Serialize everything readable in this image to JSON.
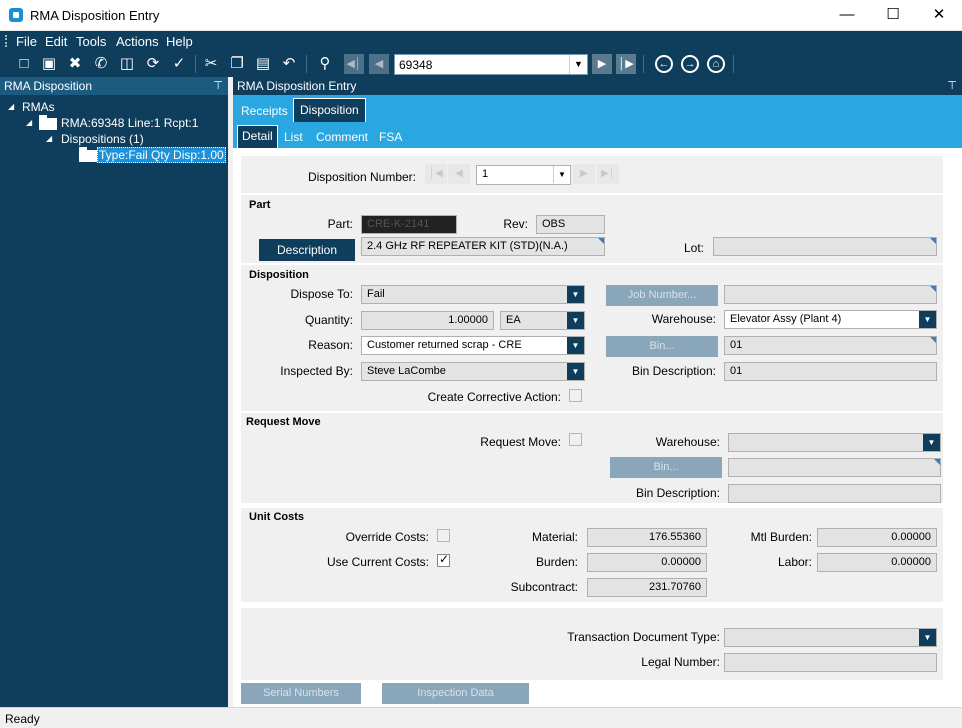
{
  "window": {
    "title": "RMA Disposition Entry",
    "minimize_glyph": "—",
    "maximize_glyph": "☐",
    "close_glyph": "✕"
  },
  "menu": [
    "File",
    "Edit",
    "Tools",
    "Actions",
    "Help"
  ],
  "toolbar": {
    "record_value": "69348",
    "icons": [
      "new-icon",
      "save-icon",
      "delete-icon",
      "phone-icon",
      "attach-icon",
      "refresh-icon",
      "clear-icon",
      "cut-icon",
      "copy-icon",
      "paste-icon",
      "undo-icon",
      "search-icon",
      "first-icon",
      "prev-icon",
      "next-icon",
      "last-icon",
      "back-icon",
      "forward-icon",
      "home-icon"
    ]
  },
  "left_panel": {
    "title": "RMA Disposition",
    "tree": {
      "root": "RMAs",
      "rma": "RMA:69348 Line:1 Rcpt:1",
      "dispositions": "Dispositions (1)",
      "item": "Type:Fail Qty Disp:1.00"
    }
  },
  "right_panel": {
    "title": "RMA Disposition Entry",
    "tabs": [
      "Receipts",
      "Disposition"
    ],
    "active_tab": "Disposition",
    "subtabs": [
      "Detail",
      "List",
      "Comment",
      "FSA"
    ],
    "active_subtab": "Detail"
  },
  "form": {
    "disposition_number": {
      "label": "Disposition Number:",
      "value": "1"
    },
    "part_group": {
      "title": "Part",
      "part_label": "Part:",
      "part_value": "CRE-K-2141",
      "rev_label": "Rev:",
      "rev_value": "OBS",
      "description_button": "Description",
      "description_value": "2.4 GHz RF REPEATER KIT (STD)(N.A.)",
      "lot_label": "Lot:",
      "lot_value": ""
    },
    "disposition_group": {
      "title": "Disposition",
      "dispose_to_label": "Dispose To:",
      "dispose_to_value": "Fail",
      "quantity_label": "Quantity:",
      "quantity_value": "1.00000",
      "uom_value": "EA",
      "reason_label": "Reason:",
      "reason_value": "Customer returned scrap - CRE",
      "inspected_by_label": "Inspected By:",
      "inspected_by_value": "Steve LaCombe",
      "corrective_label": "Create Corrective Action:",
      "job_number_button": "Job Number...",
      "job_number_value": "",
      "warehouse_label": "Warehouse:",
      "warehouse_value": "Elevator Assy (Plant 4)",
      "bin_button": "Bin...",
      "bin_value": "01",
      "bin_desc_label": "Bin Description:",
      "bin_desc_value": "01"
    },
    "request_move_group": {
      "title": "Request Move",
      "request_move_label": "Request Move:",
      "warehouse_label": "Warehouse:",
      "warehouse_value": "",
      "bin_button": "Bin...",
      "bin_value": "",
      "bin_desc_label": "Bin Description:",
      "bin_desc_value": ""
    },
    "unit_costs_group": {
      "title": "Unit Costs",
      "override_label": "Override Costs:",
      "use_current_label": "Use Current Costs:",
      "use_current_checked": true,
      "material_label": "Material:",
      "material_value": "176.55360",
      "burden_label": "Burden:",
      "burden_value": "0.00000",
      "subcontract_label": "Subcontract:",
      "subcontract_value": "231.70760",
      "mtl_burden_label": "Mtl Burden:",
      "mtl_burden_value": "0.00000",
      "labor_label": "Labor:",
      "labor_value": "0.00000"
    },
    "transaction_group": {
      "doc_type_label": "Transaction Document Type:",
      "doc_type_value": "",
      "legal_number_label": "Legal Number:",
      "legal_number_value": ""
    },
    "buttons": {
      "serial_numbers": "Serial Numbers",
      "inspection_data": "Inspection Data"
    }
  },
  "status": "Ready",
  "colors": {
    "navy": "#0f3d5c",
    "tab_blue": "#2aa7e0",
    "selection_blue": "#1e90d8",
    "disabled_button": "#8aa6bb"
  }
}
